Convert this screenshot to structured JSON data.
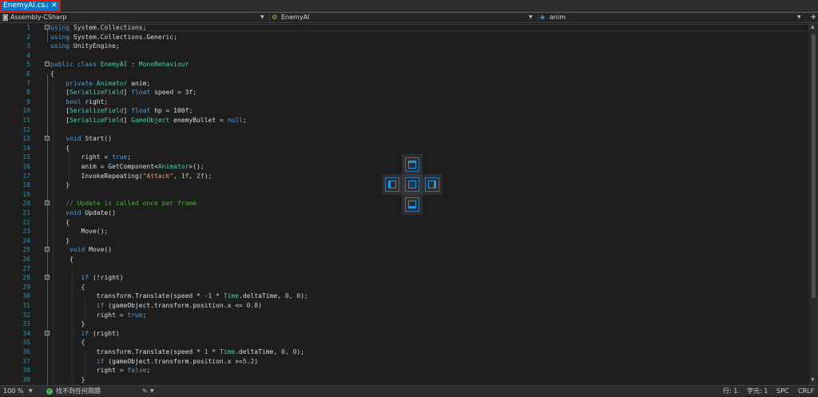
{
  "tabs": [
    {
      "label": "EnemyAI.cs",
      "pin_icon": "pin-icon",
      "close_icon": "close-icon"
    }
  ],
  "navbar": {
    "project": "Assembly-CSharp",
    "type": "EnemyAI",
    "member": "anim"
  },
  "code_lines": [
    {
      "n": "1"
    },
    {
      "n": "2"
    },
    {
      "n": "3"
    },
    {
      "n": "4"
    },
    {
      "n": "5"
    },
    {
      "n": "6"
    },
    {
      "n": "7"
    },
    {
      "n": "8"
    },
    {
      "n": "9"
    },
    {
      "n": "10"
    },
    {
      "n": "11"
    },
    {
      "n": "12"
    },
    {
      "n": "13"
    },
    {
      "n": "14"
    },
    {
      "n": "15"
    },
    {
      "n": "16"
    },
    {
      "n": "17"
    },
    {
      "n": "18"
    },
    {
      "n": "19"
    },
    {
      "n": "20"
    },
    {
      "n": "21"
    },
    {
      "n": "22"
    },
    {
      "n": "23"
    },
    {
      "n": "24"
    },
    {
      "n": "25"
    },
    {
      "n": "26"
    },
    {
      "n": "27"
    },
    {
      "n": "28"
    },
    {
      "n": "29"
    },
    {
      "n": "30"
    },
    {
      "n": "31"
    },
    {
      "n": "32"
    },
    {
      "n": "33"
    },
    {
      "n": "34"
    },
    {
      "n": "35"
    },
    {
      "n": "36"
    },
    {
      "n": "37"
    },
    {
      "n": "38"
    },
    {
      "n": "39"
    }
  ],
  "code": {
    "l1": [
      "using",
      " System.Collections;"
    ],
    "l2": [
      "using",
      " System.Collections.Generic;"
    ],
    "l3": [
      "using",
      " UnityEngine;"
    ],
    "l5": [
      "public class ",
      "EnemyAI",
      " : ",
      "MonoBehaviour"
    ],
    "l6": "{",
    "l7": [
      "    private ",
      "Animator",
      " anim;"
    ],
    "l8": [
      "    [",
      "SerializeField",
      "] ",
      "float",
      " speed = ",
      "3f",
      ";"
    ],
    "l9": [
      "    ",
      "bool",
      " right;"
    ],
    "l10": [
      "    [",
      "SerializeField",
      "] ",
      "float",
      " hp = ",
      "100f",
      ";"
    ],
    "l11": [
      "    [",
      "SerializeField",
      "] ",
      "GameObject",
      " enemyBullet = ",
      "null",
      ";"
    ],
    "l13": [
      "    ",
      "void",
      " Start()"
    ],
    "l14": "    {",
    "l15": [
      "        right = ",
      "true",
      ";"
    ],
    "l16": [
      "        anim = GetComponent<",
      "Animator",
      ">();"
    ],
    "l17": [
      "        InvokeRepeating(",
      "\"Attack\"",
      ", ",
      "1f",
      ", ",
      "2f",
      ");"
    ],
    "l18": "    }",
    "l20": "    // Update is called once per frame",
    "l21": [
      "    ",
      "void",
      " Update()"
    ],
    "l22": "    {",
    "l23": "        Move();",
    "l24": "    }",
    "l25": [
      "     ",
      "void",
      " Move()"
    ],
    "l26": "     {",
    "l28": [
      "        ",
      "if",
      " (!right)"
    ],
    "l29": "        {",
    "l30": [
      "            transform.Translate(speed * ",
      "-1",
      " * ",
      "Time",
      ".deltaTime, ",
      "0",
      ", ",
      "0",
      ");"
    ],
    "l31": [
      "            ",
      "if",
      " (gameObject.transform.position.x <= ",
      "0.8",
      ")"
    ],
    "l32": [
      "            right = ",
      "true",
      ";"
    ],
    "l33": "        }",
    "l34": [
      "        ",
      "if",
      " (right)"
    ],
    "l35": "        {",
    "l36": [
      "            transform.Translate(speed * ",
      "1",
      " * ",
      "Time",
      ".deltaTime, ",
      "0",
      ", ",
      "0",
      ");"
    ],
    "l37": [
      "            ",
      "if",
      " (gameObject.transform.position.x >=",
      "5.2",
      ")"
    ],
    "l38": [
      "            right = ",
      "false",
      ";"
    ],
    "l39": "        }"
  },
  "status": {
    "zoom": "100 %",
    "issues": "找不到任何問題",
    "line": "行: 1",
    "col": "字元: 1",
    "whitespace": "SPC",
    "eol": "CRLF"
  },
  "colors": {
    "accent": "#007acc",
    "keyword": "#569cd6",
    "type": "#4ec9b0",
    "string": "#d69d85",
    "comment": "#57a64a",
    "number": "#b5cea8",
    "linenum": "#2b91af"
  }
}
